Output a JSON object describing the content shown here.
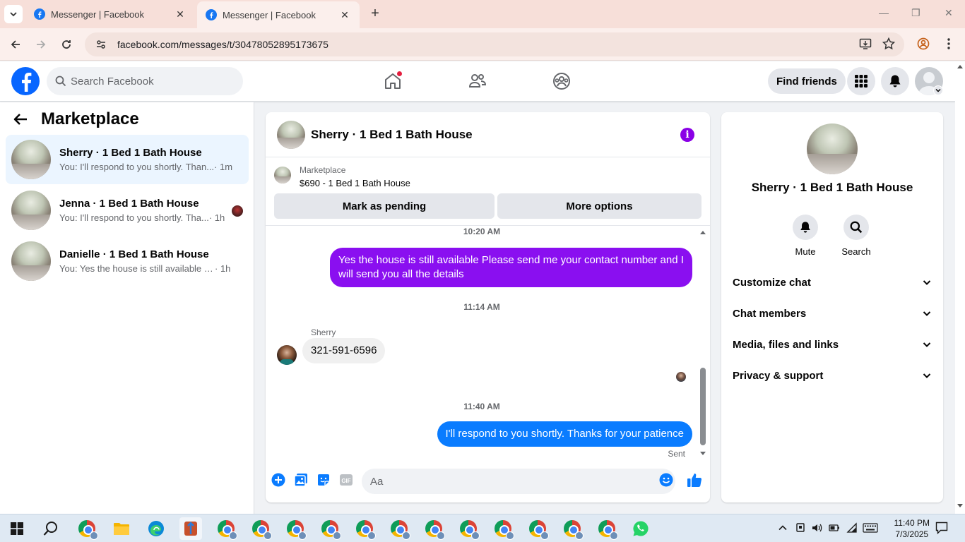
{
  "browser": {
    "tabs": [
      {
        "title": "Messenger | Facebook",
        "active": false
      },
      {
        "title": "Messenger | Facebook",
        "active": true
      }
    ],
    "url": "facebook.com/messages/t/30478052895173675"
  },
  "header": {
    "search_placeholder": "Search Facebook",
    "find_friends_label": "Find friends",
    "home_has_notification": true
  },
  "sidebar": {
    "title": "Marketplace",
    "chats": [
      {
        "name": "Sherry · 1 Bed 1 Bath House",
        "snippet": "You: I'll respond to you shortly. Than...",
        "time": "· 1m",
        "active": true
      },
      {
        "name": "Jenna · 1 Bed 1 Bath House",
        "snippet": "You: I'll respond to you shortly. Tha...",
        "time": "· 1h",
        "active": false
      },
      {
        "name": "Danielle · 1 Bed 1 Bath House",
        "snippet": "You: Yes the house is still available Ple...",
        "time": "· 1h",
        "active": false
      }
    ]
  },
  "conversation": {
    "title": "Sherry · 1 Bed 1 Bath House",
    "marketplace_label": "Marketplace",
    "listing": "$690 - 1 Bed 1 Bath House",
    "mark_pending_label": "Mark as pending",
    "more_options_label": "More options",
    "messages": [
      {
        "timestamp": "10:20 AM"
      },
      {
        "from": "me",
        "text": "Yes the house is still available Please send me your contact number and I will send you all the details"
      },
      {
        "timestamp": "11:14 AM"
      },
      {
        "from": "Sherry",
        "sender_label": "Sherry",
        "text": "321-591-6596"
      },
      {
        "timestamp": "11:40 AM"
      },
      {
        "from": "me",
        "text": "I'll respond to you shortly. Thanks for your patience",
        "status": "Sent"
      }
    ],
    "composer_placeholder": "Aa"
  },
  "info_panel": {
    "name": "Sherry · 1 Bed 1 Bath House",
    "actions": [
      {
        "label": "Mute",
        "icon": "bell-icon"
      },
      {
        "label": "Search",
        "icon": "search-icon"
      }
    ],
    "sections": [
      "Customize chat",
      "Chat members",
      "Media, files and links",
      "Privacy & support"
    ]
  },
  "taskbar": {
    "time": "11:40 PM",
    "date": "7/3/2025"
  },
  "colors": {
    "fb_blue": "#0866ff",
    "my_bubble_purple": "#8a0ff0",
    "my_bubble_blue": "#0a7cff",
    "accent_purple": "#8a00e6"
  }
}
